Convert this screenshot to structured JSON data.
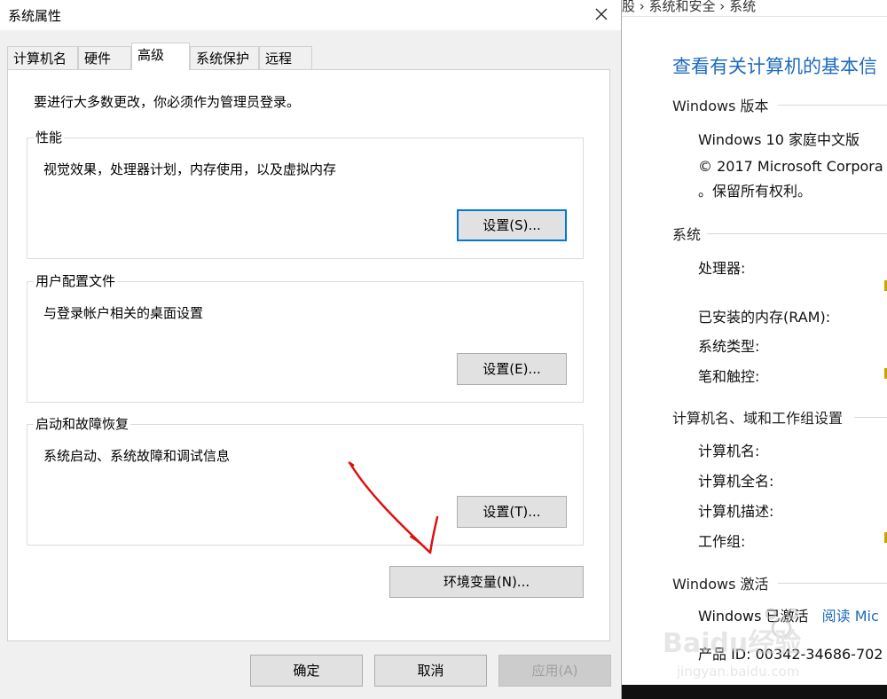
{
  "dialog": {
    "title": "系统属性",
    "tabs": [
      "计算机名",
      "硬件",
      "高级",
      "系统保护",
      "远程"
    ],
    "active_tab": "高级",
    "admin_note": "要进行大多数更改，你必须作为管理员登录。",
    "groups": [
      {
        "label": "性能",
        "desc": "视觉效果，处理器计划，内存使用，以及虚拟内存",
        "button": "设置(S)..."
      },
      {
        "label": "用户配置文件",
        "desc": "与登录帐户相关的桌面设置",
        "button": "设置(E)..."
      },
      {
        "label": "启动和故障恢复",
        "desc": "系统启动、系统故障和调试信息",
        "button": "设置(T)..."
      }
    ],
    "env_button": "环境变量(N)...",
    "ok": "确定",
    "cancel": "取消",
    "apply": "应用(A)",
    "annotation_color": "#e01010"
  },
  "system_window": {
    "breadcrumb": "股 › 系统和安全 › 系统",
    "heading": "查看有关计算机的基本信",
    "windows_edition": {
      "title": "Windows 版本",
      "edition": "Windows 10 家庭中文版",
      "copyright": "© 2017 Microsoft Corpora",
      "rights": "。保留所有权利。"
    },
    "system": {
      "title": "系统",
      "rows": [
        "处理器:",
        "已安装的内存(RAM):",
        "系统类型:",
        "笔和触控:"
      ]
    },
    "computer_name": {
      "title": "计算机名、域和工作组设置",
      "rows": [
        "计算机名:",
        "计算机全名:",
        "计算机描述:",
        "工作组:"
      ]
    },
    "activation": {
      "title": "Windows 激活",
      "status": "Windows 已激活",
      "link": "阅读 Mic",
      "product_id": "产品 ID: 00342-34686-702"
    },
    "watermark": {
      "brand": "Baidu经验",
      "url": "jingyan.baidu.com"
    },
    "accent": "#1e6bbd"
  }
}
